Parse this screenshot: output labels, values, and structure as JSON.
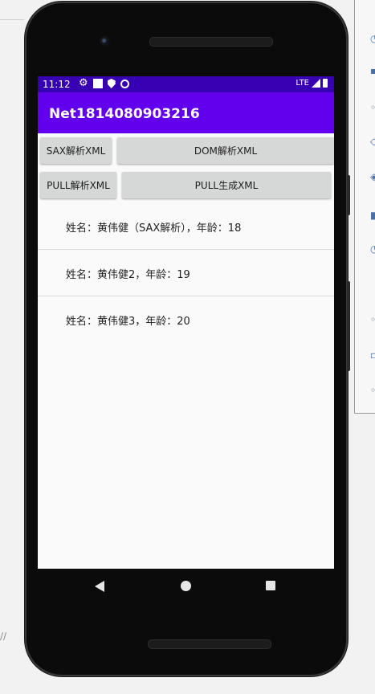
{
  "status_bar": {
    "time": "11:12",
    "network": "LTE",
    "icons": [
      "settings-icon",
      "notification-square-icon",
      "shield-icon",
      "sync-circle-icon",
      "signal-icon",
      "battery-icon"
    ]
  },
  "app_bar": {
    "title": "Net1814080903216"
  },
  "buttons": {
    "sax": "SAX解析XML",
    "dom": "DOM解析XML",
    "pull_parse": "PULL解析XML",
    "pull_generate": "PULL生成XML"
  },
  "list": [
    {
      "text": "姓名：黄伟健（SAX解析），年龄：18"
    },
    {
      "text": "姓名：黄伟健2，年龄：19"
    },
    {
      "text": "姓名：黄伟健3，年龄：20"
    }
  ],
  "navigation": {
    "icons": [
      "back-icon",
      "home-icon",
      "recents-icon"
    ]
  },
  "colors": {
    "status_bar": "#3700b3",
    "app_bar": "#6200ee",
    "button_bg": "#d6d7d7",
    "screen_bg": "#fafafa"
  }
}
